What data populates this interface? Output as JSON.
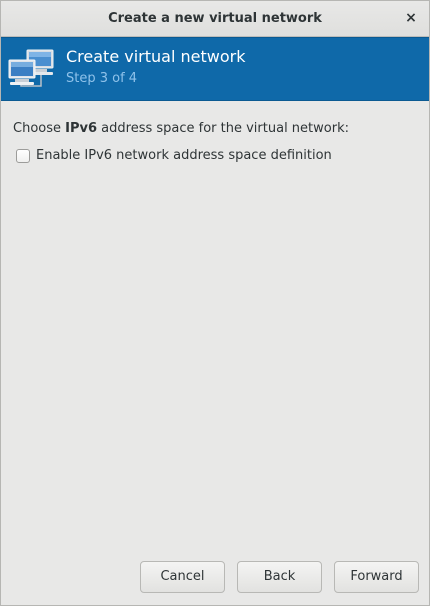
{
  "window": {
    "title": "Create a new virtual network",
    "close_glyph": "×"
  },
  "header": {
    "title": "Create virtual network",
    "step": "Step 3 of 4",
    "icon": "network-computers-icon"
  },
  "content": {
    "prompt_prefix": "Choose ",
    "prompt_bold": "IPv6",
    "prompt_suffix": " address space for the virtual network:",
    "enable_ipv6_label": "Enable IPv6 network address space definition",
    "enable_ipv6_checked": false
  },
  "buttons": {
    "cancel": "Cancel",
    "back": "Back",
    "forward": "Forward"
  },
  "colors": {
    "header_band": "#0f69a9",
    "step_text": "#8fc2ea",
    "background": "#e8e8e7"
  }
}
